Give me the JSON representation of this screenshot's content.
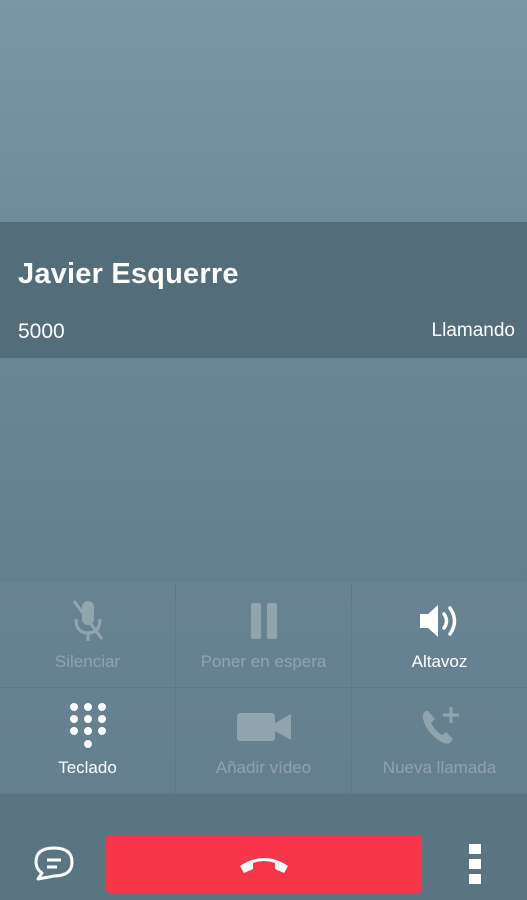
{
  "call": {
    "contact_name": "Javier Esquerre",
    "number": "5000",
    "status": "Llamando"
  },
  "controls": {
    "mute": {
      "label": "Silenciar",
      "icon": "mic-off-icon",
      "enabled": false
    },
    "hold": {
      "label": "Poner en espera",
      "icon": "pause-icon",
      "enabled": false
    },
    "speaker": {
      "label": "Altavoz",
      "icon": "speaker-icon",
      "enabled": true
    },
    "keypad": {
      "label": "Teclado",
      "icon": "dialpad-icon",
      "enabled": true
    },
    "add_video": {
      "label": "Añadir vídeo",
      "icon": "video-camera-icon",
      "enabled": false
    },
    "new_call": {
      "label": "Nueva llamada",
      "icon": "add-call-icon",
      "enabled": false
    }
  },
  "bottom_bar": {
    "chat_icon": "chat-bubble-icon",
    "hangup_icon": "phone-hangup-icon",
    "more_icon": "more-vertical-icon"
  },
  "colors": {
    "hangup": "#f73749",
    "info_band": "#546d7b",
    "bottom_bar": "#5a7482"
  }
}
